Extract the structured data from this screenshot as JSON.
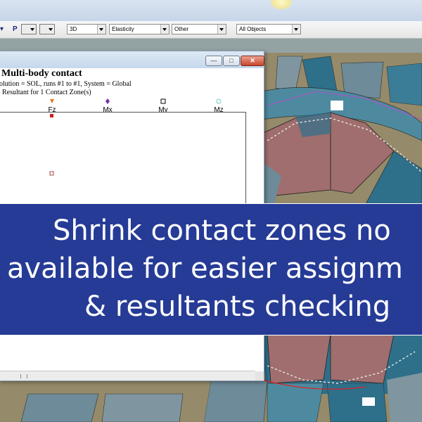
{
  "toolbar": {
    "p_label": "P",
    "dropdowns": [
      "3D",
      "Elasticity",
      "Other",
      "All Objects"
    ]
  },
  "window": {
    "heading": "Multi-body contact",
    "subtitle_1": "olution = SOL, runs #1 to #1, System = Global",
    "subtitle_2": "Resultant for 1 Contact Zone(s)",
    "buttons": {
      "minimize": "—",
      "maximize": "□",
      "close": "✕"
    }
  },
  "chart_data": {
    "type": "scatter",
    "legend": [
      "Fz",
      "Mx",
      "My",
      "Mz"
    ],
    "legend_colors": [
      "#e07a21",
      "#7b2fa8",
      "#000000",
      "#6ad2c8"
    ],
    "points_visible": [
      {
        "series": "Fz",
        "marker": "square-red"
      },
      {
        "series": "Fz",
        "marker": "square-open"
      },
      {
        "series": "Fz",
        "marker": "star-blue"
      }
    ]
  },
  "banner": {
    "line1": "Shrink contact zones no",
    "line2": "available for easier assignm",
    "line3": "& resultants checking"
  },
  "colors": {
    "banner_bg": "#263b96",
    "model_teal": "#2e6f8a",
    "model_rose": "#a06e6e",
    "model_olive": "#958a6a"
  }
}
